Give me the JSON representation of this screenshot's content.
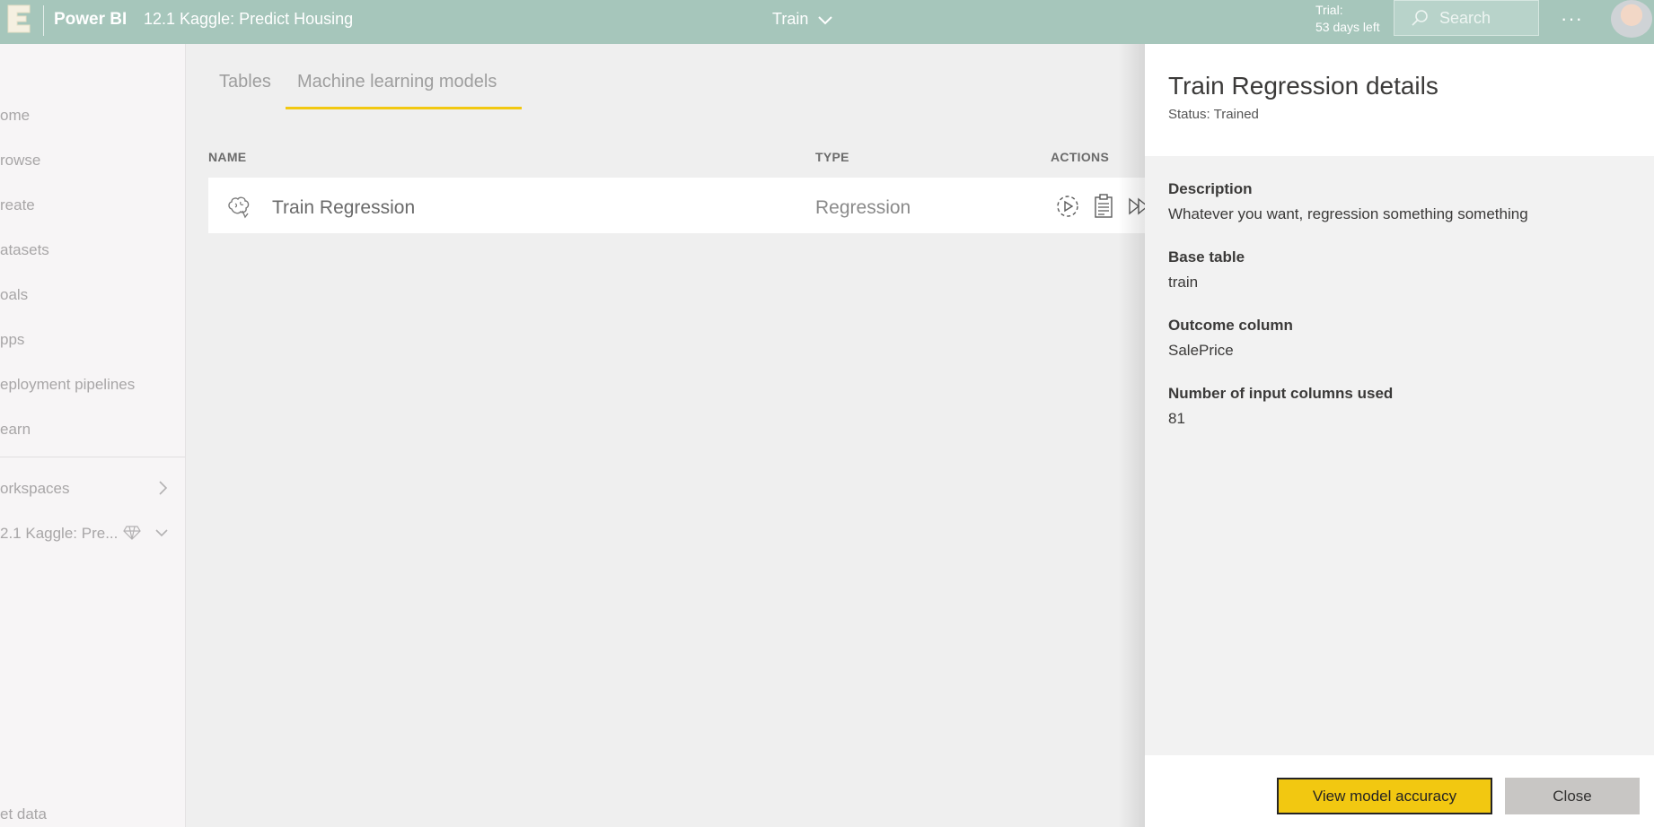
{
  "topbar": {
    "app_name": "Power BI",
    "workspace": "12.1 Kaggle: Predict Housing",
    "center_dropdown": "Train",
    "trial_line1": "Trial:",
    "trial_line2": "53 days left",
    "search_placeholder": "Search",
    "more_label": "···"
  },
  "leftnav": {
    "items": [
      {
        "label": "ome"
      },
      {
        "label": "rowse"
      },
      {
        "label": "reate"
      },
      {
        "label": "atasets"
      },
      {
        "label": "oals"
      },
      {
        "label": "pps"
      },
      {
        "label": "eployment pipelines"
      },
      {
        "label": "earn"
      },
      {
        "label": "orkspaces"
      },
      {
        "label": "2.1 Kaggle: Pre..."
      },
      {
        "label": "et data"
      }
    ]
  },
  "main": {
    "tabs": [
      {
        "label": "Tables"
      },
      {
        "label": "Machine learning models"
      }
    ],
    "active_tab": "Machine learning models",
    "columns": {
      "name": "NAME",
      "type": "TYPE",
      "actions": "ACTIONS"
    },
    "rows": [
      {
        "name": "Train Regression",
        "type": "Regression"
      }
    ]
  },
  "panel": {
    "title": "Train Regression details",
    "status": "Status: Trained",
    "fields": [
      {
        "label": "Description",
        "value": "Whatever you want, regression something something"
      },
      {
        "label": "Base table",
        "value": "train"
      },
      {
        "label": "Outcome column",
        "value": "SalePrice"
      },
      {
        "label": "Number of input columns used",
        "value": "81"
      }
    ],
    "primary_button": "View model accuracy",
    "secondary_button": "Close"
  },
  "colors": {
    "topbar": "#a6c6bb",
    "accent_yellow": "#f2c811",
    "nav_bg": "#f7f5f6",
    "content_bg": "#efefef"
  }
}
